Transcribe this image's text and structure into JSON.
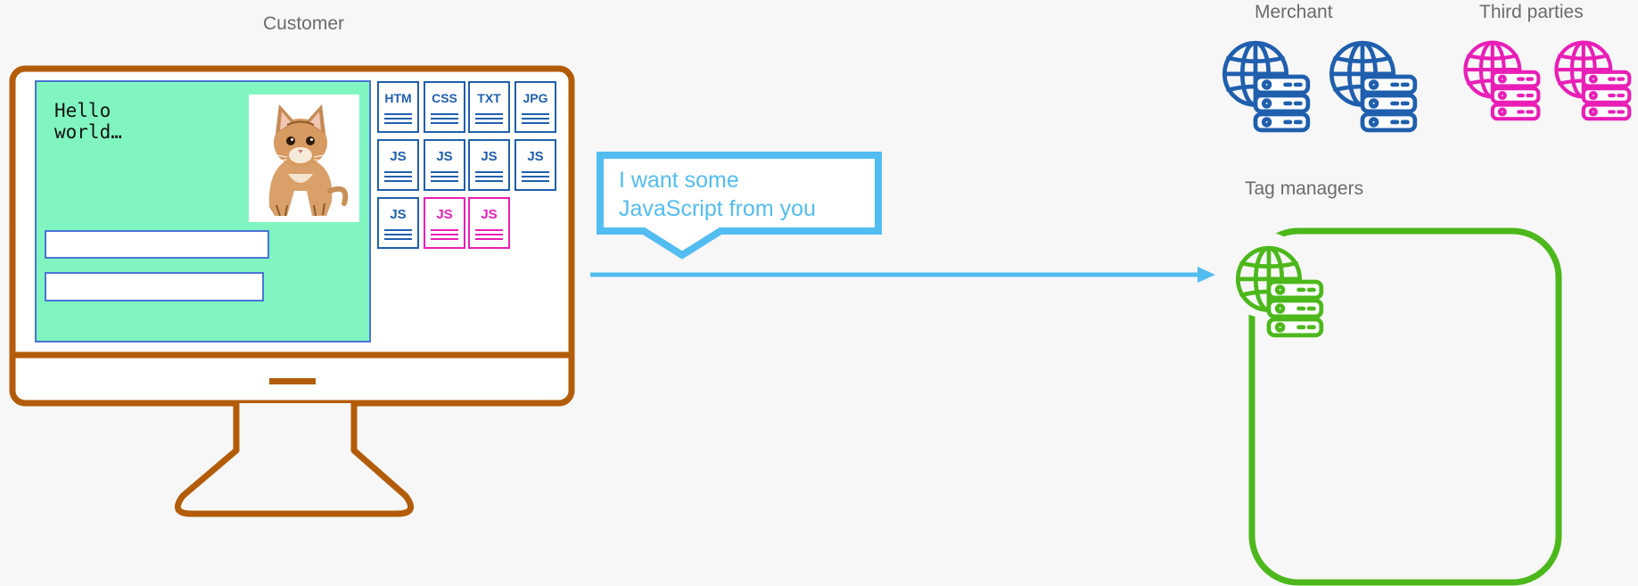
{
  "labels": {
    "customer": "Customer",
    "merchant": "Merchant",
    "third_parties": "Third parties",
    "tag_managers": "Tag managers"
  },
  "screen": {
    "greeting_line1": "Hello",
    "greeting_line2": "world…"
  },
  "files": [
    {
      "label": "HTM",
      "color": "#1f5fae"
    },
    {
      "label": "CSS",
      "color": "#1f5fae"
    },
    {
      "label": "TXT",
      "color": "#1f5fae"
    },
    {
      "label": "JPG",
      "color": "#1f5fae"
    },
    {
      "label": "JS",
      "color": "#1f5fae"
    },
    {
      "label": "JS",
      "color": "#1f5fae"
    },
    {
      "label": "JS",
      "color": "#1f5fae"
    },
    {
      "label": "JS",
      "color": "#1f5fae"
    },
    {
      "label": "JS",
      "color": "#1f5fae"
    },
    {
      "label": "JS",
      "color": "#e91eb7"
    },
    {
      "label": "JS",
      "color": "#e91eb7"
    }
  ],
  "speech_bubble": {
    "line1": "I want some",
    "line2": "JavaScript from you"
  },
  "colors": {
    "monitor": "#b35c0a",
    "screen_bg": "#80f5c0",
    "merchant": "#1f5fae",
    "third_party": "#e91eb7",
    "tag_manager": "#4cb81b",
    "request": "#52bdf0"
  },
  "icons": {
    "merchant_servers": [
      "globe-server-icon",
      "globe-server-icon"
    ],
    "third_party_servers": [
      "globe-server-icon",
      "globe-server-icon"
    ],
    "tag_manager_server": "globe-server-icon"
  }
}
